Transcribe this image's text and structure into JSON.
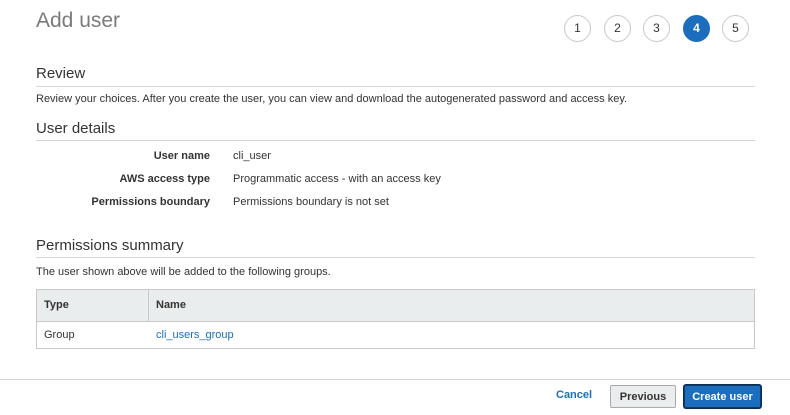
{
  "page": {
    "title": "Add user"
  },
  "wizard": {
    "steps": [
      {
        "label": "1",
        "active": false
      },
      {
        "label": "2",
        "active": false
      },
      {
        "label": "3",
        "active": false
      },
      {
        "label": "4",
        "active": true
      },
      {
        "label": "5",
        "active": false
      }
    ]
  },
  "review": {
    "title": "Review",
    "description": "Review your choices. After you create the user, you can view and download the autogenerated password and access key."
  },
  "user_details": {
    "title": "User details",
    "rows": [
      {
        "label": "User name",
        "value": "cli_user"
      },
      {
        "label": "AWS access type",
        "value": "Programmatic access - with an access key"
      },
      {
        "label": "Permissions boundary",
        "value": "Permissions boundary is not set"
      }
    ]
  },
  "permissions": {
    "title": "Permissions summary",
    "description": "The user shown above will be added to the following groups.",
    "columns": [
      "Type",
      "Name"
    ],
    "rows": [
      {
        "type": "Group",
        "name": "cli_users_group"
      }
    ]
  },
  "footer": {
    "cancel": "Cancel",
    "previous": "Previous",
    "create": "Create user"
  },
  "colors": {
    "accent": "#1a6ebd"
  }
}
